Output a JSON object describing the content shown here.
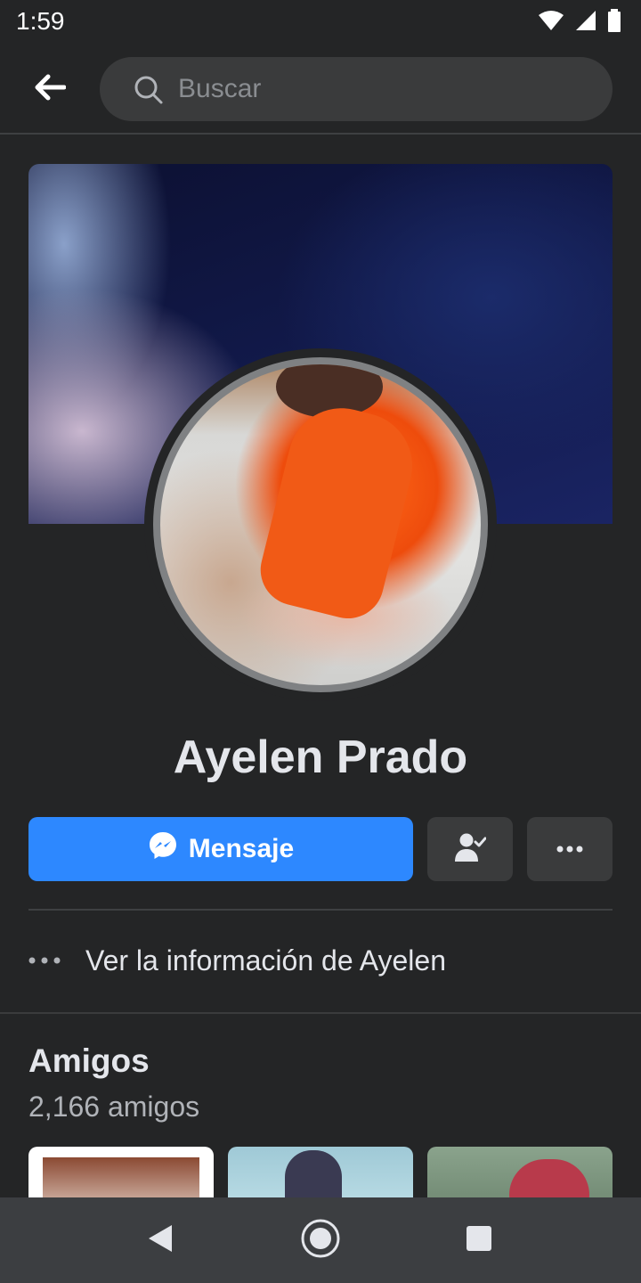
{
  "status_bar": {
    "time": "1:59",
    "icons": [
      "wifi-icon",
      "cellular-signal-icon",
      "battery-icon"
    ]
  },
  "header": {
    "back_icon": "arrow-left-icon",
    "search": {
      "placeholder": "Buscar",
      "value": ""
    }
  },
  "profile": {
    "name": "Ayelen Prado",
    "message_button": {
      "label": "Mensaje",
      "icon": "messenger-icon"
    },
    "friend_button_icon": "friends-check-icon",
    "more_button_icon": "more-dots-icon",
    "info_link": "Ver la información de Ayelen"
  },
  "friends": {
    "title": "Amigos",
    "count_text": "2,166 amigos"
  },
  "nav_bar": {
    "icons": [
      "nav-back-icon",
      "nav-home-icon",
      "nav-recents-icon"
    ]
  },
  "colors": {
    "background": "#242526",
    "accent": "#2d88ff",
    "button_secondary": "#3a3b3c",
    "text_primary": "#e4e6eb",
    "text_secondary": "#b0b3b8"
  }
}
